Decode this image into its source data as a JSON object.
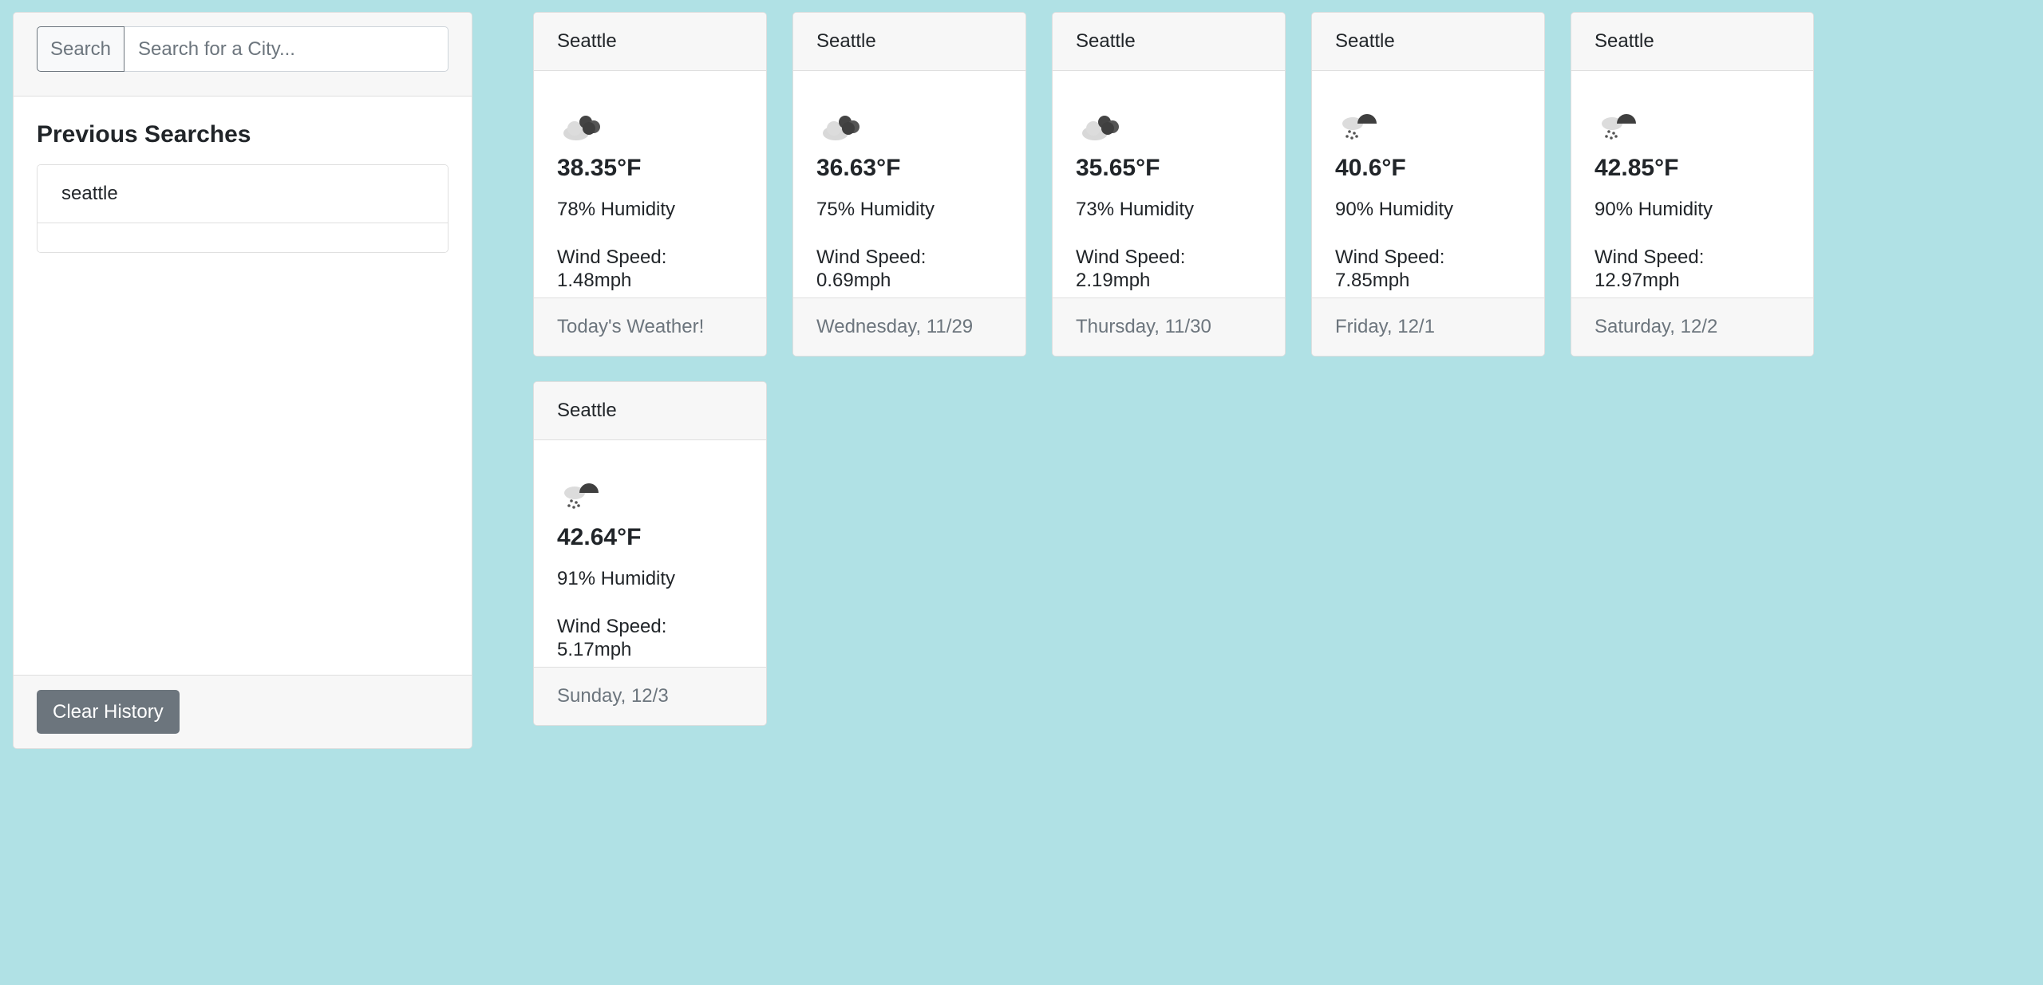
{
  "search": {
    "button_label": "Search",
    "placeholder": "Search for a City..."
  },
  "history": {
    "title": "Previous Searches",
    "items": [
      "seattle"
    ],
    "clear_label": "Clear History"
  },
  "cards": [
    {
      "city": "Seattle",
      "icon": "cloudy-icon",
      "temp": "38.35°F",
      "humidity": "78% Humidity",
      "wind": "Wind Speed: 1.48mph",
      "footer": "Today's Weather!"
    },
    {
      "city": "Seattle",
      "icon": "cloudy-icon",
      "temp": "36.63°F",
      "humidity": "75% Humidity",
      "wind": "Wind Speed: 0.69mph",
      "footer": "Wednesday, 11/29"
    },
    {
      "city": "Seattle",
      "icon": "cloudy-icon",
      "temp": "35.65°F",
      "humidity": "73% Humidity",
      "wind": "Wind Speed: 2.19mph",
      "footer": "Thursday, 11/30"
    },
    {
      "city": "Seattle",
      "icon": "rain-cloud-icon",
      "temp": "40.6°F",
      "humidity": "90% Humidity",
      "wind": "Wind Speed: 7.85mph",
      "footer": "Friday, 12/1"
    },
    {
      "city": "Seattle",
      "icon": "rain-cloud-icon",
      "temp": "42.85°F",
      "humidity": "90% Humidity",
      "wind": "Wind Speed: 12.97mph",
      "footer": "Saturday, 12/2"
    },
    {
      "city": "Seattle",
      "icon": "rain-cloud-icon",
      "temp": "42.64°F",
      "humidity": "91% Humidity",
      "wind": "Wind Speed: 5.17mph",
      "footer": "Sunday, 12/3"
    }
  ],
  "colors": {
    "background": "#b0e1e5",
    "secondary": "#6c757d"
  }
}
